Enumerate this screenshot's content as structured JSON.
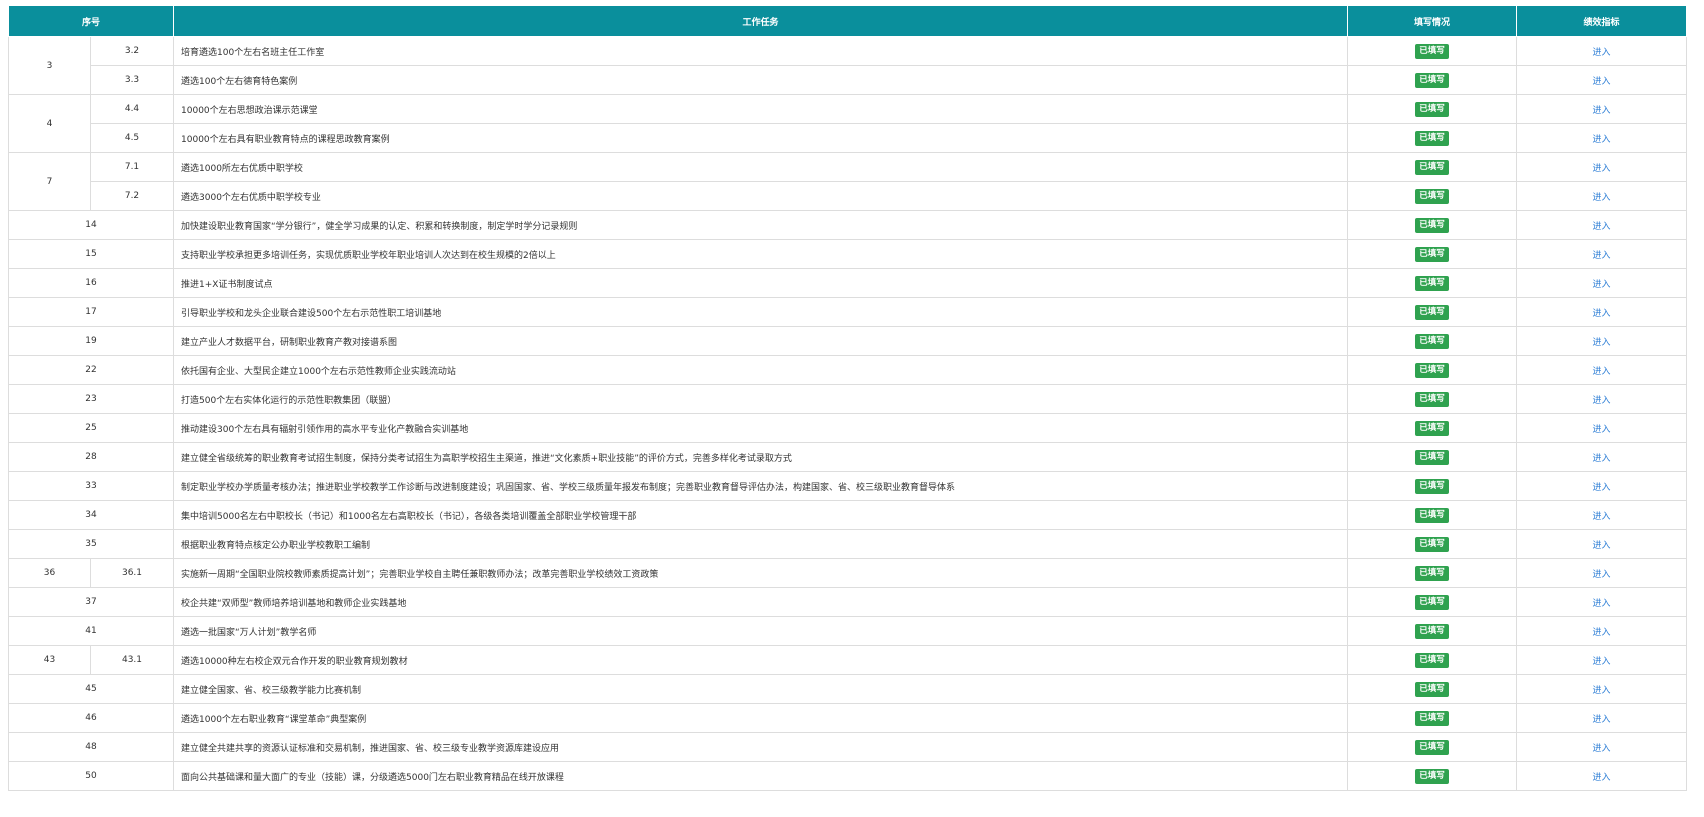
{
  "header": {
    "seq": "序号",
    "task": "工作任务",
    "status": "填写情况",
    "metric": "绩效指标"
  },
  "status_label": "已填写",
  "link_label": "进入",
  "colors": {
    "header_bg": "#0a8f9c",
    "badge_bg": "#2fa24f",
    "link": "#2f7fd6"
  },
  "rows": [
    {
      "seq": "3",
      "sub": "3.2",
      "task": "培育遴选100个左右名班主任工作室"
    },
    {
      "seq": "3",
      "sub": "3.3",
      "task": "遴选100个左右德育特色案例"
    },
    {
      "seq": "4",
      "sub": "4.4",
      "task": "10000个左右思想政治课示范课堂"
    },
    {
      "seq": "4",
      "sub": "4.5",
      "task": "10000个左右具有职业教育特点的课程思政教育案例"
    },
    {
      "seq": "7",
      "sub": "7.1",
      "task": "遴选1000所左右优质中职学校"
    },
    {
      "seq": "7",
      "sub": "7.2",
      "task": "遴选3000个左右优质中职学校专业"
    },
    {
      "seq": "14",
      "sub": "",
      "task": "加快建设职业教育国家“学分银行”，健全学习成果的认定、积累和转换制度，制定学时学分记录规则"
    },
    {
      "seq": "15",
      "sub": "",
      "task": "支持职业学校承担更多培训任务，实现优质职业学校年职业培训人次达到在校生规模的2倍以上"
    },
    {
      "seq": "16",
      "sub": "",
      "task": "推进1+X证书制度试点"
    },
    {
      "seq": "17",
      "sub": "",
      "task": "引导职业学校和龙头企业联合建设500个左右示范性职工培训基地"
    },
    {
      "seq": "19",
      "sub": "",
      "task": "建立产业人才数据平台，研制职业教育产教对接谱系图"
    },
    {
      "seq": "22",
      "sub": "",
      "task": "依托国有企业、大型民企建立1000个左右示范性教师企业实践流动站"
    },
    {
      "seq": "23",
      "sub": "",
      "task": "打造500个左右实体化运行的示范性职教集团（联盟）"
    },
    {
      "seq": "25",
      "sub": "",
      "task": "推动建设300个左右具有辐射引领作用的高水平专业化产教融合实训基地"
    },
    {
      "seq": "28",
      "sub": "",
      "task": "建立健全省级统筹的职业教育考试招生制度，保持分类考试招生为高职学校招生主渠道，推进“文化素质+职业技能”的评价方式，完善多样化考试录取方式"
    },
    {
      "seq": "33",
      "sub": "",
      "task": "制定职业学校办学质量考核办法；推进职业学校教学工作诊断与改进制度建设；巩固国家、省、学校三级质量年报发布制度；完善职业教育督导评估办法，构建国家、省、校三级职业教育督导体系"
    },
    {
      "seq": "34",
      "sub": "",
      "task": "集中培训5000名左右中职校长（书记）和1000名左右高职校长（书记），各级各类培训覆盖全部职业学校管理干部"
    },
    {
      "seq": "35",
      "sub": "",
      "task": "根据职业教育特点核定公办职业学校教职工编制"
    },
    {
      "seq": "36",
      "sub": "36.1",
      "task": "实施新一周期“全国职业院校教师素质提高计划”；完善职业学校自主聘任兼职教师办法；改革完善职业学校绩效工资政策"
    },
    {
      "seq": "37",
      "sub": "",
      "task": "校企共建“双师型”教师培养培训基地和教师企业实践基地"
    },
    {
      "seq": "41",
      "sub": "",
      "task": "遴选一批国家“万人计划”教学名师"
    },
    {
      "seq": "43",
      "sub": "43.1",
      "task": "遴选10000种左右校企双元合作开发的职业教育规划教材"
    },
    {
      "seq": "45",
      "sub": "",
      "task": "建立健全国家、省、校三级教学能力比赛机制"
    },
    {
      "seq": "46",
      "sub": "",
      "task": "遴选1000个左右职业教育“课堂革命”典型案例"
    },
    {
      "seq": "48",
      "sub": "",
      "task": "建立健全共建共享的资源认证标准和交易机制，推进国家、省、校三级专业教学资源库建设应用"
    },
    {
      "seq": "50",
      "sub": "",
      "task": "面向公共基础课和量大面广的专业（技能）课，分级遴选5000门左右职业教育精品在线开放课程"
    }
  ]
}
